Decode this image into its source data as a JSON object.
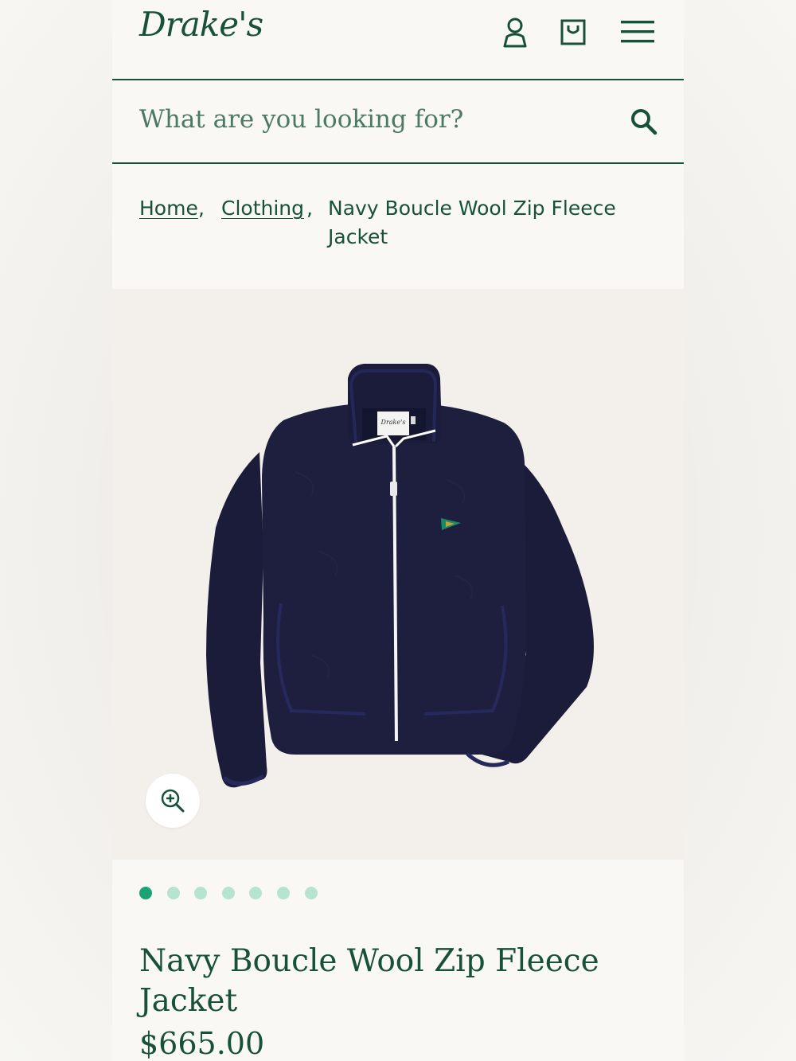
{
  "header": {
    "logo_text": "Drake's",
    "icons": [
      "account-icon",
      "bag-icon",
      "menu-icon"
    ]
  },
  "search": {
    "placeholder": "What are you looking for?",
    "value": "",
    "icon": "search-icon"
  },
  "breadcrumb": {
    "items": [
      {
        "label": "Home"
      },
      {
        "label": "Clothing"
      },
      {
        "label": "Navy Boucle Wool Zip Fleece Jacket"
      }
    ],
    "separator": ","
  },
  "gallery": {
    "image_count": 7,
    "active_index": 0,
    "zoom_icon": "zoom-in-icon",
    "label_text": "Drake's"
  },
  "product": {
    "title": "Navy Boucle Wool Zip Fleece Jacket",
    "price": "$665.00"
  },
  "colors": {
    "brand_green": "#17513a",
    "text_green": "#4b7a63",
    "dot_active": "#1aa374",
    "dot_inactive": "#b6e4d1",
    "jacket_navy": "#1b1c3a",
    "background": "#faf8f4"
  }
}
